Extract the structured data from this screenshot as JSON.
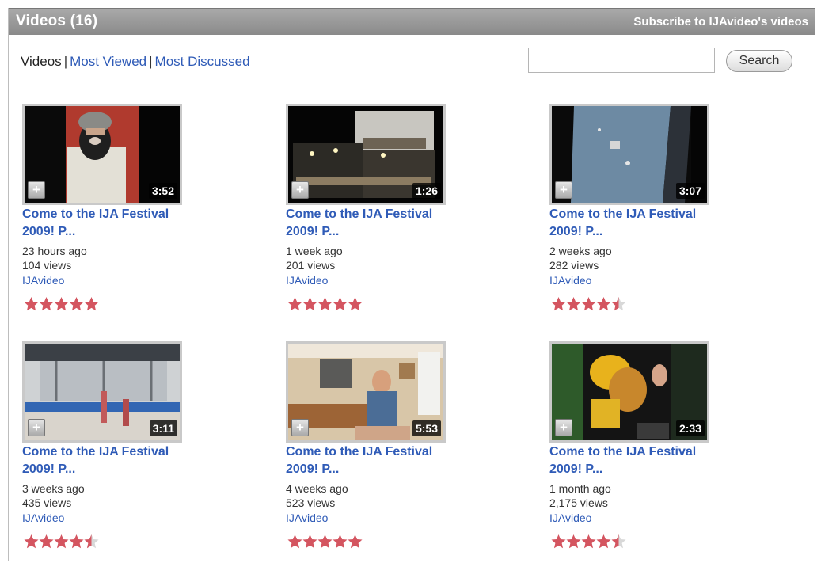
{
  "header": {
    "title": "Videos (16)",
    "subscribe_label": "Subscribe to IJAvideo's videos"
  },
  "view_tabs": {
    "videos": "Videos",
    "separator": "|",
    "most_viewed": "Most Viewed",
    "most_discussed": "Most Discussed"
  },
  "search": {
    "value": "",
    "button_label": "Search"
  },
  "icons": {
    "add": "add-to-quicklist-icon",
    "rating": "star-icon"
  },
  "colors": {
    "link": "#2f5bb7",
    "star": "#d45560",
    "header": "#9a9a9a"
  },
  "videos": [
    {
      "title": "Come to the IJA Festival 2009! P...",
      "duration": "3:52",
      "age": "23 hours ago",
      "views": "104 views",
      "channel": "IJAvideo",
      "rating": 5
    },
    {
      "title": "Come to the IJA Festival 2009! P...",
      "duration": "1:26",
      "age": "1 week ago",
      "views": "201 views",
      "channel": "IJAvideo",
      "rating": 5
    },
    {
      "title": "Come to the IJA Festival 2009! P...",
      "duration": "3:07",
      "age": "2 weeks ago",
      "views": "282 views",
      "channel": "IJAvideo",
      "rating": 4.5
    },
    {
      "title": "Come to the IJA Festival 2009! P...",
      "duration": "3:11",
      "age": "3 weeks ago",
      "views": "435 views",
      "channel": "IJAvideo",
      "rating": 4.5
    },
    {
      "title": "Come to the IJA Festival 2009! P...",
      "duration": "5:53",
      "age": "4 weeks ago",
      "views": "523 views",
      "channel": "IJAvideo",
      "rating": 5
    },
    {
      "title": "Come to the IJA Festival 2009! P...",
      "duration": "2:33",
      "age": "1 month ago",
      "views": "2,175 views",
      "channel": "IJAvideo",
      "rating": 4.5
    }
  ]
}
